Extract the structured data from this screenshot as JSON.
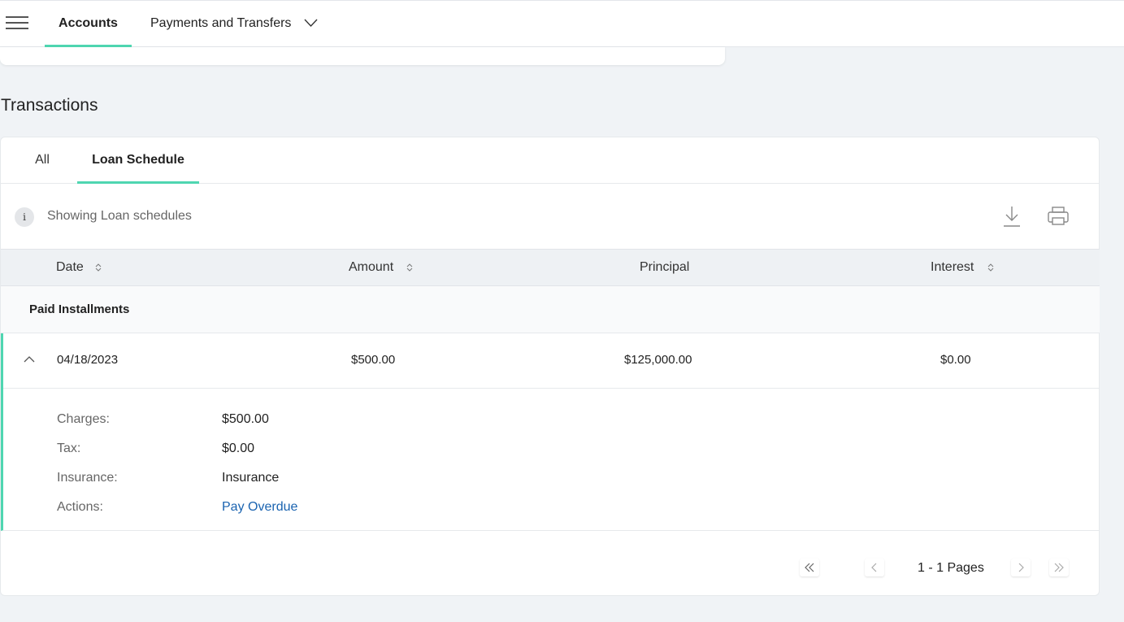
{
  "nav": {
    "accounts": "Accounts",
    "payments": "Payments and Transfers"
  },
  "section": {
    "title": "Transactions"
  },
  "tabs": [
    {
      "label": "All"
    },
    {
      "label": "Loan Schedule"
    }
  ],
  "info": {
    "text": "Showing Loan schedules",
    "icon_glyph": "i"
  },
  "table": {
    "headers": {
      "date": "Date",
      "amount": "Amount",
      "principal": "Principal",
      "interest": "Interest"
    },
    "group": "Paid Installments",
    "row": {
      "date": "04/18/2023",
      "amount": "$500.00",
      "principal": "$125,000.00",
      "interest": "$0.00"
    },
    "details": {
      "charges_label": "Charges:",
      "charges_value": "$500.00",
      "tax_label": "Tax:",
      "tax_value": "$0.00",
      "insurance_label": "Insurance:",
      "insurance_value": "Insurance",
      "actions_label": "Actions:",
      "actions_link": "Pay Overdue"
    }
  },
  "pagination": {
    "text": "1 - 1 Pages"
  },
  "colors": {
    "accent": "#4fd6b1",
    "link": "#1a63b0",
    "background": "#f0f3f6"
  }
}
